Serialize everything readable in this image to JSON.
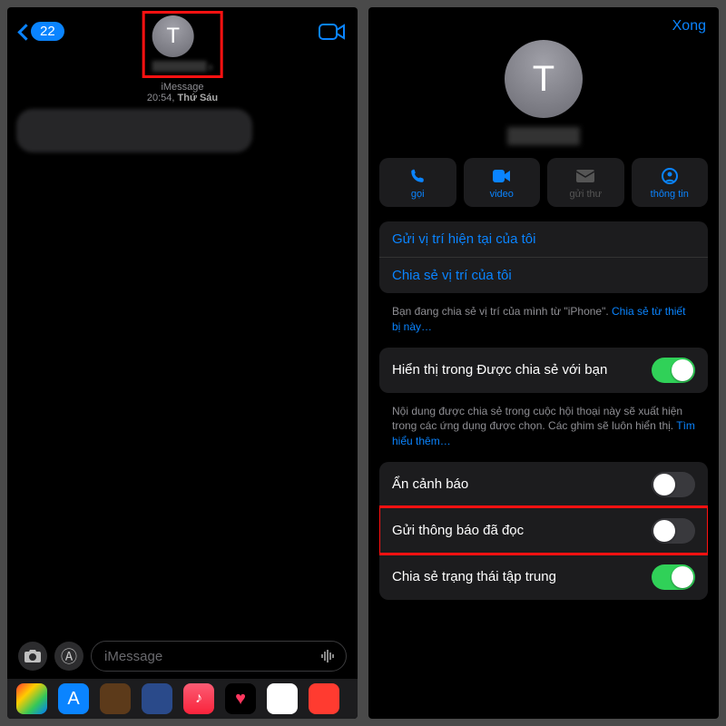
{
  "left": {
    "back_count": "22",
    "avatar_letter": "T",
    "timestamp_line1": "iMessage",
    "timestamp_time": "20:54,",
    "timestamp_day": "Thứ Sáu",
    "input_placeholder": "iMessage"
  },
  "right": {
    "done_label": "Xong",
    "avatar_letter": "T",
    "actions": {
      "call": "gọi",
      "video": "video",
      "mail": "gửi thư",
      "info": "thông tin"
    },
    "location": {
      "send_current": "Gửi vị trí hiện tại của tôi",
      "share": "Chia sẻ vị trí của tôi",
      "footnote_a": "Bạn đang chia sẻ vị trí của mình từ \"iPhone\". ",
      "footnote_link": "Chia sẻ từ thiết bị này…"
    },
    "shared": {
      "show_label": "Hiển thị trong Được chia sẻ với bạn",
      "footnote_a": "Nội dung được chia sẻ trong cuộc hội thoại này sẽ xuất hiện trong các ứng dụng được chọn. Các ghim sẽ luôn hiển thị. ",
      "footnote_link": "Tìm hiểu thêm…"
    },
    "toggles": {
      "hide_alerts": "Ẩn cảnh báo",
      "read_receipts": "Gửi thông báo đã đọc",
      "focus_status": "Chia sẻ trạng thái tập trung"
    }
  }
}
